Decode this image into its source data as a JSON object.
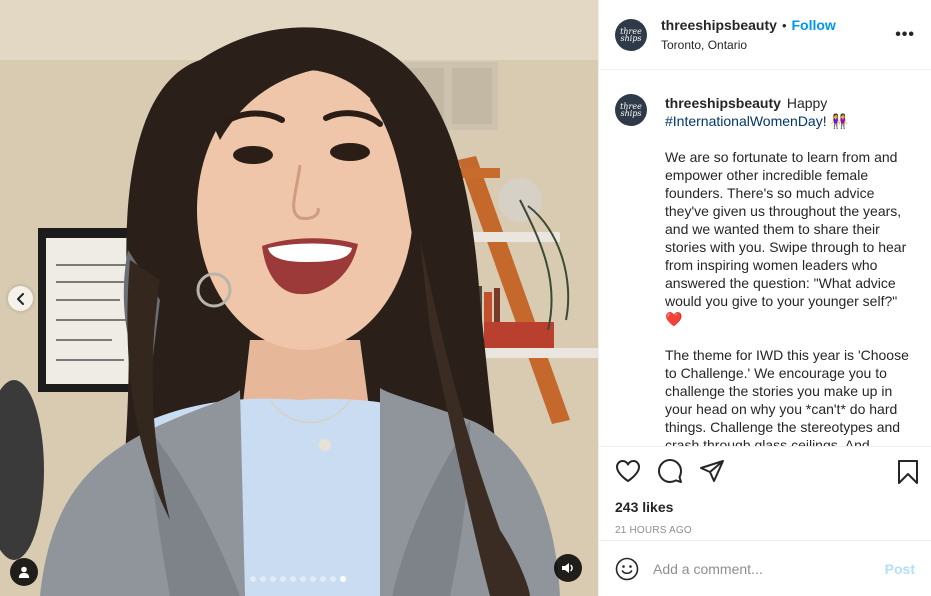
{
  "post": {
    "author": {
      "username": "threeshipsbeauty",
      "avatar_text": "three ships",
      "location": "Toronto, Ontario",
      "follow_label": "Follow",
      "separator": "•"
    },
    "caption": {
      "username": "threeshipsbeauty",
      "line1_text": "Happy",
      "hashtag": "#InternationalWomenDay",
      "line1_suffix": "! 👭",
      "paragraph2": "We are so fortunate to learn from and empower other incredible female founders. There's so much advice they've given us throughout the years, and we wanted them to share their stories with you. Swipe through to hear from inspiring women leaders who answered the question: \"What advice would you give to your younger self?\"",
      "heart": "❤️",
      "paragraph3": "The theme for IWD this year is 'Choose to Challenge.' We encourage you to challenge the stories you make up in your head on why you *can't* do hard things. Challenge the stereotypes and crash through glass ceilings. And"
    },
    "likes": "243 likes",
    "time": "21 HOURS AGO",
    "comment": {
      "placeholder": "Add a comment...",
      "post_label": "Post"
    },
    "media": {
      "carousel": {
        "count": 10,
        "active_index": 9
      }
    }
  },
  "icons": [
    "chevron-left-icon",
    "user-tag-icon",
    "speaker-icon",
    "more-icon",
    "heart-icon",
    "comment-icon",
    "share-icon",
    "bookmark-icon",
    "emoji-icon"
  ],
  "colors": {
    "link": "#0095f6",
    "hashtag": "#00376b",
    "post_disabled": "#b2dffc",
    "meta_gray": "#8e8e8e",
    "heart": "#ed4956"
  }
}
